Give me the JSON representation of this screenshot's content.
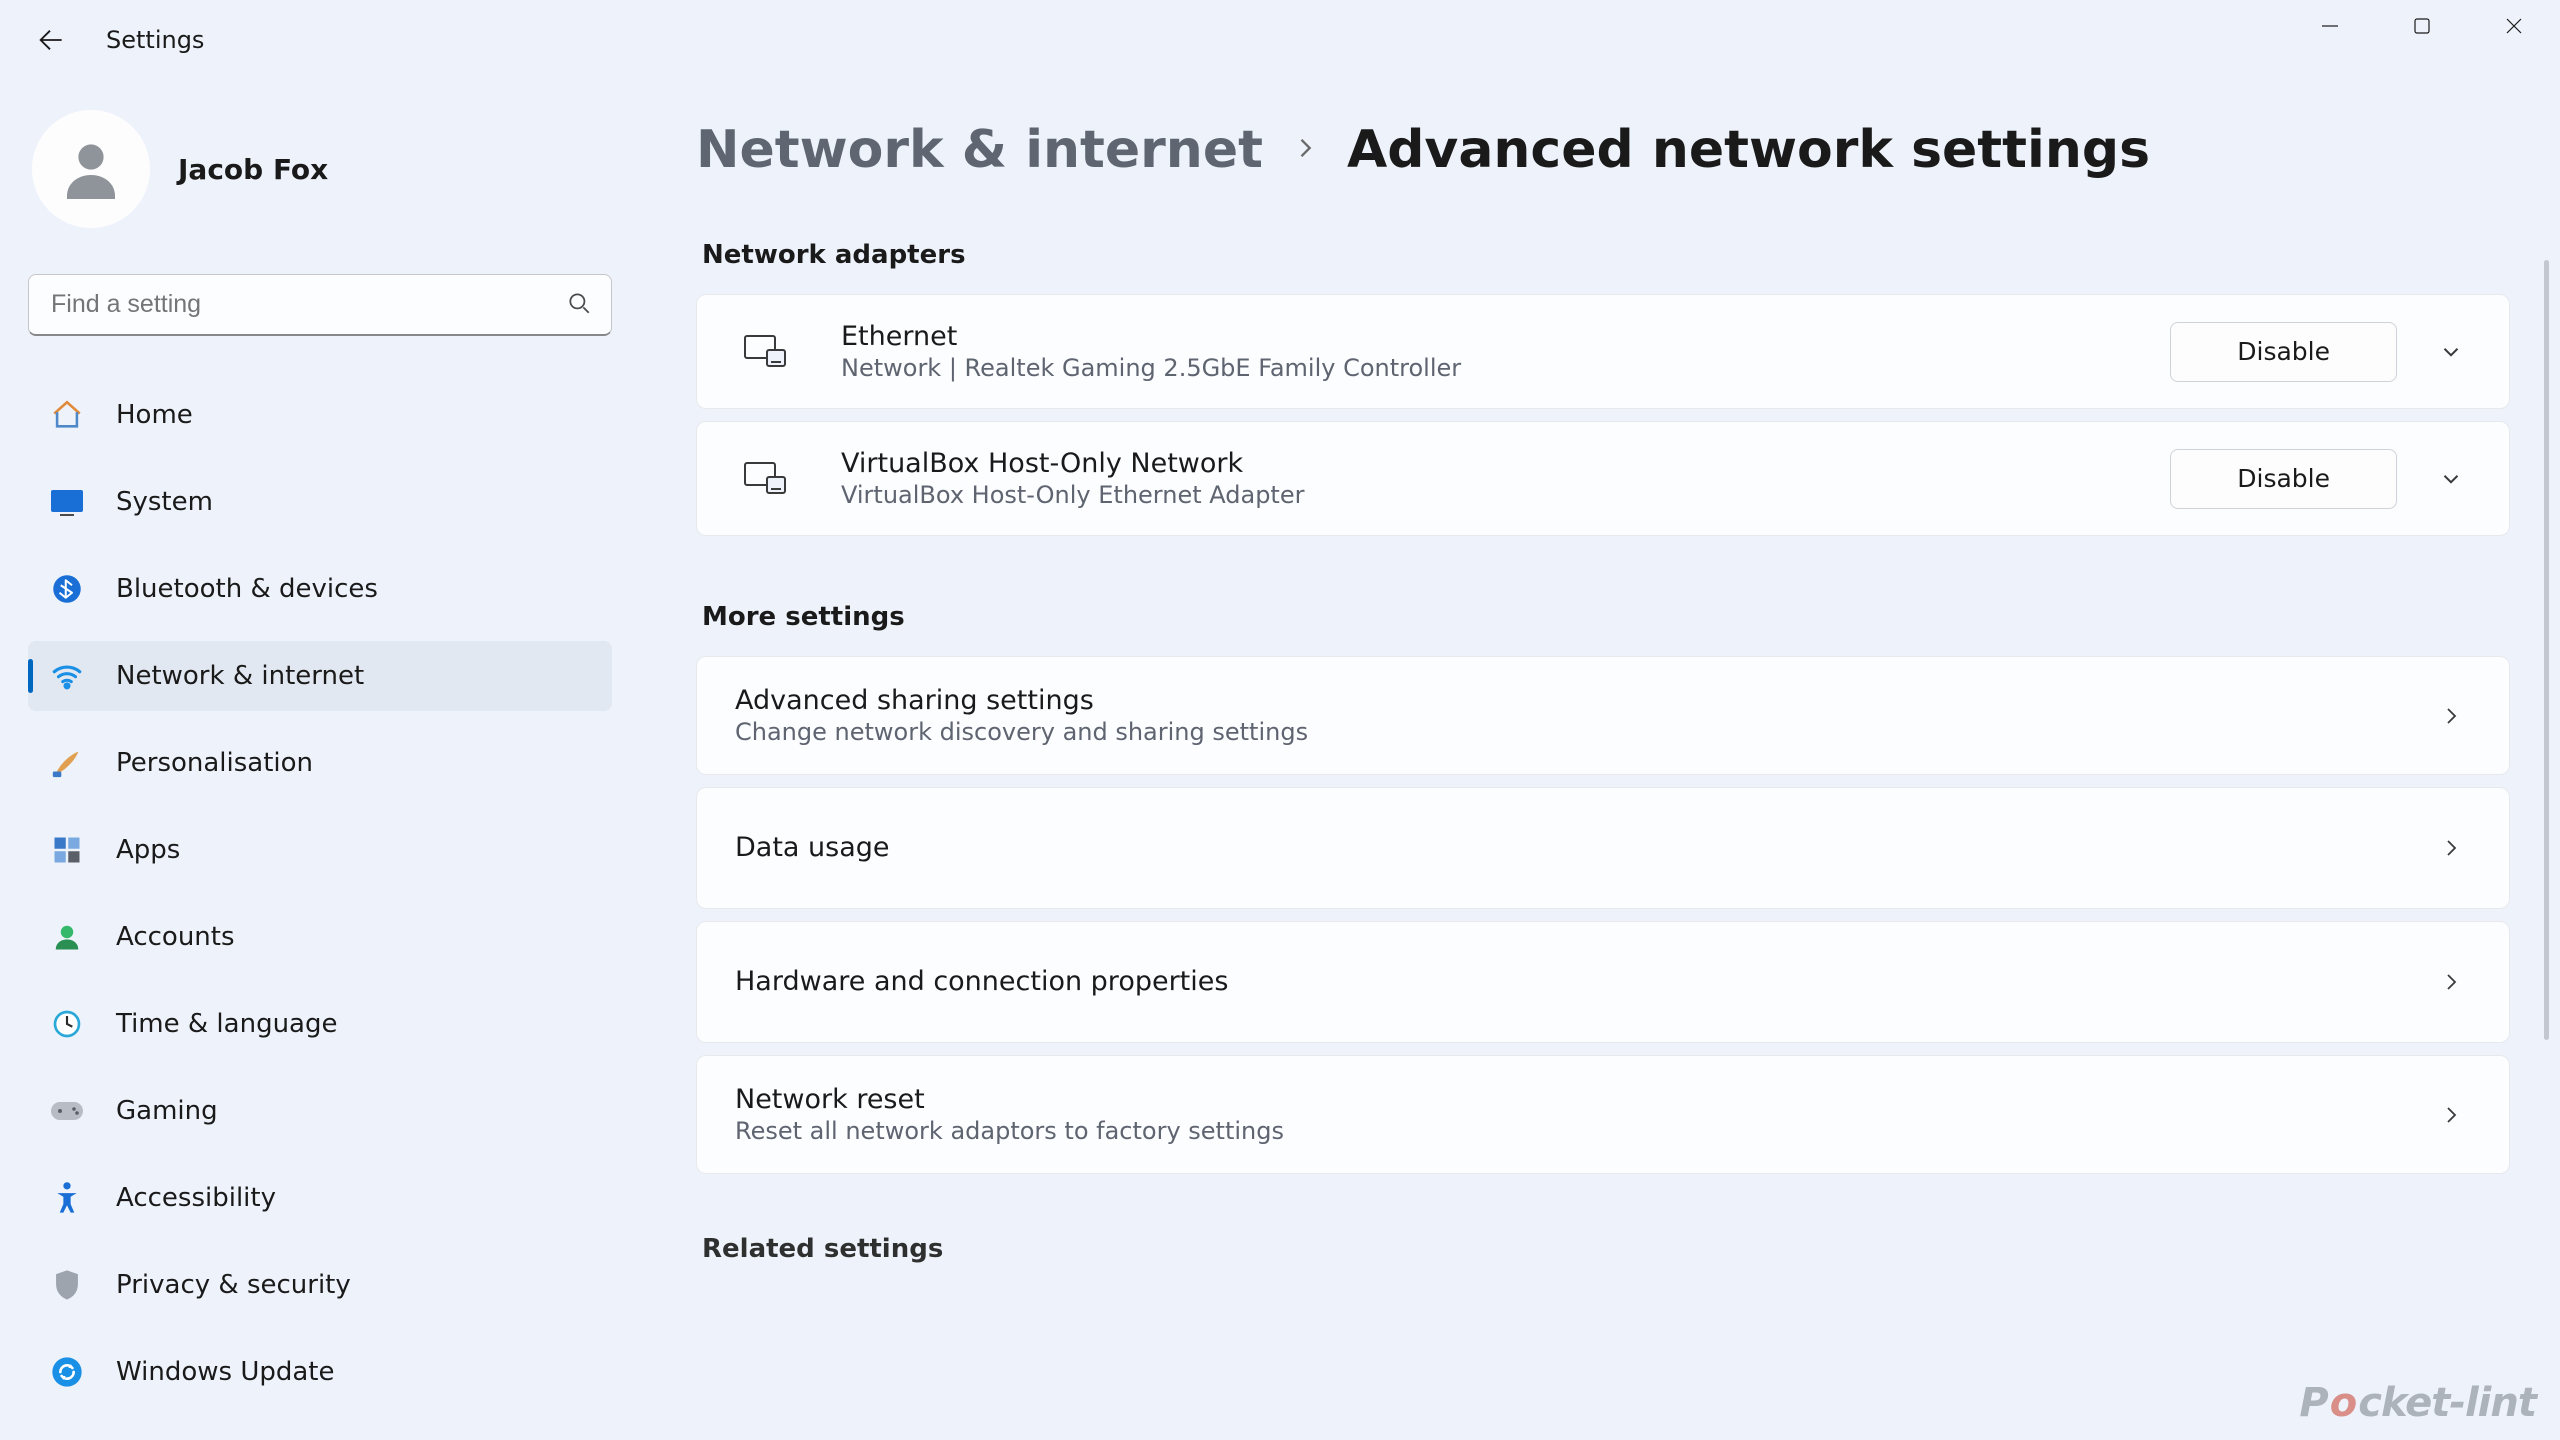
{
  "titlebar": {
    "app_title": "Settings"
  },
  "user": {
    "name": "Jacob Fox"
  },
  "search": {
    "placeholder": "Find a setting"
  },
  "nav": {
    "items": [
      {
        "id": "home",
        "label": "Home"
      },
      {
        "id": "system",
        "label": "System"
      },
      {
        "id": "bluetooth",
        "label": "Bluetooth & devices"
      },
      {
        "id": "network",
        "label": "Network & internet",
        "active": true
      },
      {
        "id": "personalisation",
        "label": "Personalisation"
      },
      {
        "id": "apps",
        "label": "Apps"
      },
      {
        "id": "accounts",
        "label": "Accounts"
      },
      {
        "id": "time",
        "label": "Time & language"
      },
      {
        "id": "gaming",
        "label": "Gaming"
      },
      {
        "id": "accessibility",
        "label": "Accessibility"
      },
      {
        "id": "privacy",
        "label": "Privacy & security"
      },
      {
        "id": "update",
        "label": "Windows Update"
      }
    ]
  },
  "breadcrumb": {
    "parent": "Network & internet",
    "current": "Advanced network settings"
  },
  "sections": {
    "adapters_heading": "Network adapters",
    "more_heading": "More settings",
    "related_heading": "Related settings"
  },
  "adapters": [
    {
      "name": "Ethernet",
      "desc": "Network | Realtek Gaming 2.5GbE Family Controller",
      "action": "Disable"
    },
    {
      "name": "VirtualBox Host-Only Network",
      "desc": "VirtualBox Host-Only Ethernet Adapter",
      "action": "Disable"
    }
  ],
  "more": [
    {
      "title": "Advanced sharing settings",
      "sub": "Change network discovery and sharing settings"
    },
    {
      "title": "Data usage",
      "sub": ""
    },
    {
      "title": "Hardware and connection properties",
      "sub": ""
    },
    {
      "title": "Network reset",
      "sub": "Reset all network adaptors to factory settings"
    }
  ],
  "watermark": {
    "pre": "P",
    "accent": "o",
    "post": "cket-lint"
  }
}
